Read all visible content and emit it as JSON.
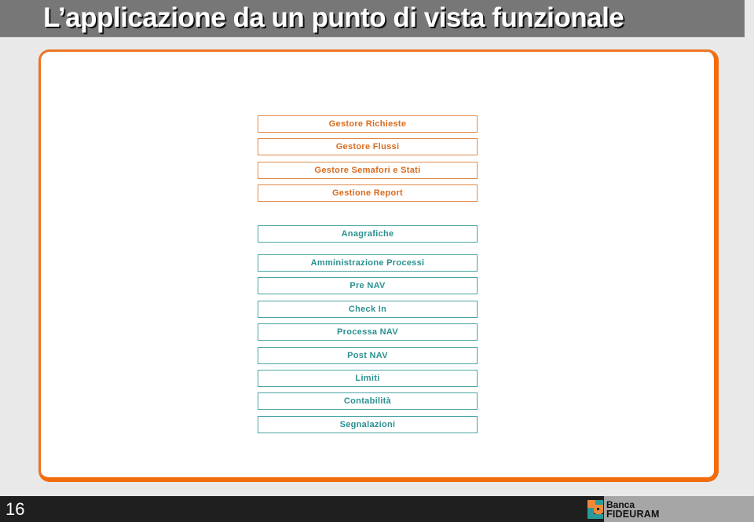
{
  "title": "L’applicazione da un punto di vista funzionale",
  "modules_orange": [
    "Gestore Richieste",
    "Gestore Flussi",
    "Gestore Semafori e Stati",
    "Gestione Report"
  ],
  "modules_teal": [
    "Anagrafiche",
    "Amministrazione Processi",
    "Pre NAV",
    "Check In",
    "Processa NAV",
    "Post NAV",
    "Limiti",
    "Contabilità",
    "Segnalazioni"
  ],
  "footer": {
    "page_number": "16",
    "logo_line1": "Banca",
    "logo_line2": "FIDEURAM"
  },
  "colors": {
    "accent_orange": "#f26c0c",
    "module_orange_text": "#d96b1e",
    "module_teal_text": "#2a9090",
    "title_bar": "#777777"
  }
}
